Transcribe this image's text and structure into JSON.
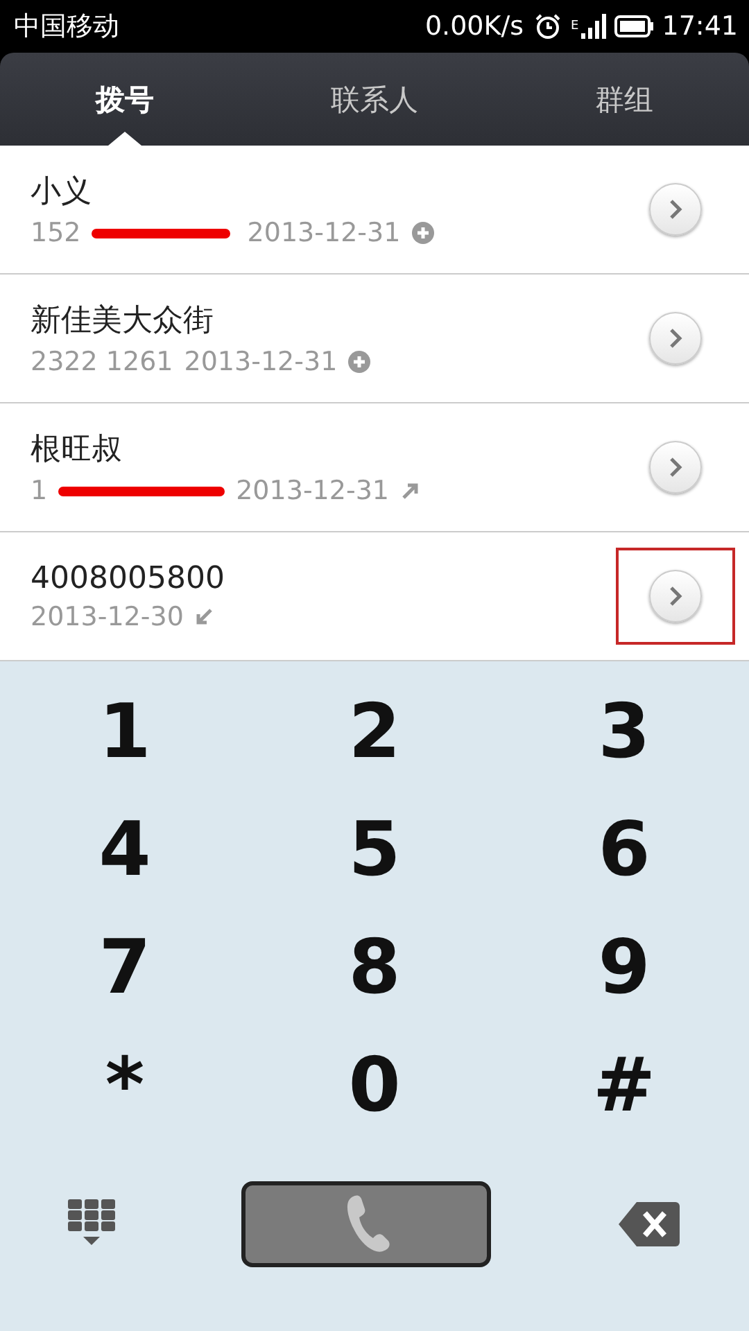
{
  "status_bar": {
    "carrier": "中国移动",
    "speed": "0.00K/s",
    "network": "E",
    "time": "17:41"
  },
  "tabs": [
    {
      "label": "拨号",
      "selected": true
    },
    {
      "label": "联系人",
      "selected": false
    },
    {
      "label": "群组",
      "selected": false
    }
  ],
  "calls": [
    {
      "name": "小义",
      "number": "152",
      "date": "2013-12-31",
      "kind": "new",
      "redacted": true,
      "highlighted": false
    },
    {
      "name": "新佳美大众街",
      "number": "2322 1261",
      "date": "2013-12-31",
      "kind": "new",
      "redacted": false,
      "highlighted": false
    },
    {
      "name": "根旺叔",
      "number": "1",
      "date": "2013-12-31",
      "kind": "outgoing",
      "redacted": true,
      "highlighted": false
    },
    {
      "name": "4008005800",
      "date": "2013-12-30",
      "kind": "incoming",
      "redacted": false,
      "highlighted": true
    }
  ],
  "keys": [
    "1",
    "2",
    "3",
    "4",
    "5",
    "6",
    "7",
    "8",
    "9",
    "*",
    "0",
    "#"
  ]
}
